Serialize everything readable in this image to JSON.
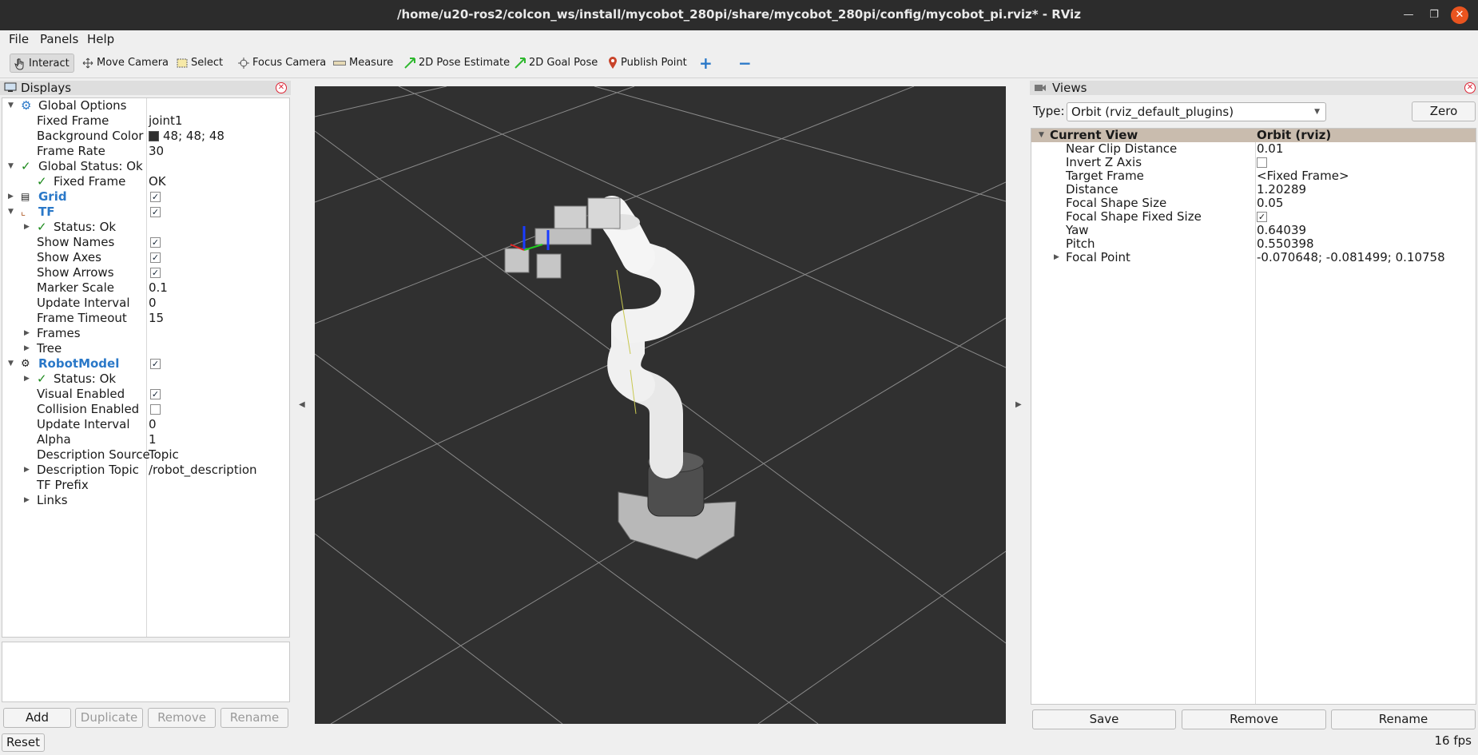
{
  "window": {
    "title": "/home/u20-ros2/colcon_ws/install/mycobot_280pi/share/mycobot_280pi/config/mycobot_pi.rviz* - RViz"
  },
  "menu": [
    "File",
    "Panels",
    "Help"
  ],
  "toolbar": {
    "interact": "Interact",
    "move_camera": "Move Camera",
    "select": "Select",
    "focus_camera": "Focus Camera",
    "measure": "Measure",
    "pose_estimate": "2D Pose Estimate",
    "goal_pose": "2D Goal Pose",
    "publish_point": "Publish Point"
  },
  "displays": {
    "title": "Displays",
    "global_options": "Global Options",
    "fixed_frame_label": "Fixed Frame",
    "fixed_frame_value": "joint1",
    "background_color_label": "Background Color",
    "background_color_value": "48; 48; 48",
    "frame_rate_label": "Frame Rate",
    "frame_rate_value": "30",
    "global_status": "Global Status: Ok",
    "status_fixed_frame_label": "Fixed Frame",
    "status_fixed_frame_value": "OK",
    "grid": "Grid",
    "tf": "TF",
    "tf_status": "Status: Ok",
    "show_names": "Show Names",
    "show_axes": "Show Axes",
    "show_arrows": "Show Arrows",
    "marker_scale_label": "Marker Scale",
    "marker_scale_value": "0.1",
    "update_interval_label": "Update Interval",
    "update_interval_value": "0",
    "frame_timeout_label": "Frame Timeout",
    "frame_timeout_value": "15",
    "frames": "Frames",
    "tree": "Tree",
    "robot_model": "RobotModel",
    "rm_status": "Status: Ok",
    "visual_enabled": "Visual Enabled",
    "collision_enabled": "Collision Enabled",
    "rm_update_interval_label": "Update Interval",
    "rm_update_interval_value": "0",
    "alpha_label": "Alpha",
    "alpha_value": "1",
    "desc_source_label": "Description Source",
    "desc_source_value": "Topic",
    "desc_topic_label": "Description Topic",
    "desc_topic_value": "/robot_description",
    "tf_prefix_label": "TF Prefix",
    "links": "Links",
    "buttons": {
      "add": "Add",
      "duplicate": "Duplicate",
      "remove": "Remove",
      "rename": "Rename"
    },
    "reset": "Reset"
  },
  "views": {
    "title": "Views",
    "type_label": "Type:",
    "type_value": "Orbit (rviz_default_plugins)",
    "zero": "Zero",
    "current_view": "Current View",
    "current_view_value": "Orbit (rviz)",
    "near_clip_label": "Near Clip Distance",
    "near_clip_value": "0.01",
    "invert_z_label": "Invert Z Axis",
    "target_frame_label": "Target Frame",
    "target_frame_value": "<Fixed Frame>",
    "distance_label": "Distance",
    "distance_value": "1.20289",
    "focal_size_label": "Focal Shape Size",
    "focal_size_value": "0.05",
    "focal_fixed_label": "Focal Shape Fixed Size",
    "yaw_label": "Yaw",
    "yaw_value": "0.64039",
    "pitch_label": "Pitch",
    "pitch_value": "0.550398",
    "focal_point_label": "Focal Point",
    "focal_point_value": "-0.070648; -0.081499; 0.10758",
    "buttons": {
      "save": "Save",
      "remove": "Remove",
      "rename": "Rename"
    }
  },
  "status": {
    "fps": "16 fps"
  }
}
